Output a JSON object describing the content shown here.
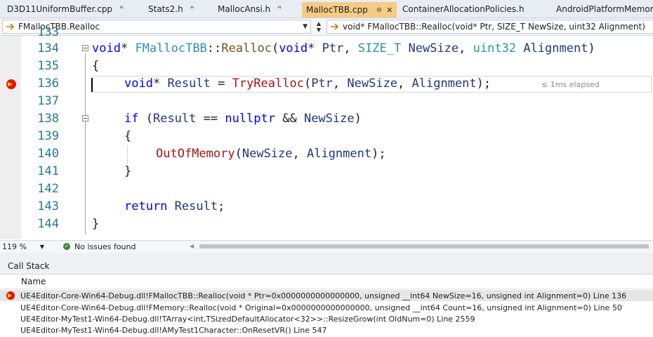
{
  "tabs": [
    {
      "label": "D3D11UniformBuffer.cpp",
      "pin": "ꟸ",
      "active": false
    },
    {
      "label": "Stats2.h",
      "pin": "ꟸ",
      "active": false
    },
    {
      "label": "MallocAnsi.h",
      "pin": "ꟸ",
      "active": false
    },
    {
      "label": "MallocTBB.cpp",
      "pin": "⊕",
      "close": "✕",
      "active": true
    },
    {
      "label": "ContainerAllocationPolicies.h",
      "pin": "",
      "active": false
    },
    {
      "label": "AndroidPlatformMemor",
      "pin": "",
      "active": false
    }
  ],
  "nav": {
    "scope": "FMallocTBB.Realloc",
    "function": "void* FMallocTBB::Realloc(void* Ptr, SIZE_T NewSize, uint32 Alignment)"
  },
  "editor": {
    "lines": [
      {
        "num": "133",
        "text": ""
      },
      {
        "num": "134"
      },
      {
        "num": "135"
      },
      {
        "num": "136"
      },
      {
        "num": "137"
      },
      {
        "num": "138"
      },
      {
        "num": "139"
      },
      {
        "num": "140"
      },
      {
        "num": "141"
      },
      {
        "num": "142"
      },
      {
        "num": "143"
      },
      {
        "num": "144"
      }
    ],
    "code": {
      "l134_void": "void",
      "l134_star": "* ",
      "l134_class": "FMallocTBB",
      "l134_sep": "::",
      "l134_fn": "Realloc",
      "l134_open": "(",
      "l134_void2": "void",
      "l134_p1": "* ",
      "l134_ptr": "Ptr",
      "l134_comma1": ", ",
      "l134_sizet": "SIZE_T",
      "l134_sp": " ",
      "l134_newsize": "NewSize",
      "l134_comma2": ", ",
      "l134_uint32": "uint32",
      "l134_sp2": " ",
      "l134_align": "Alignment",
      "l134_close": ")",
      "l135": "{",
      "l136_void": "void",
      "l136_star": "* ",
      "l136_result": "Result",
      "l136_eq": " = ",
      "l136_fn": "TryRealloc",
      "l136_open": "(",
      "l136_ptr": "Ptr",
      "l136_c1": ", ",
      "l136_newsize": "NewSize",
      "l136_c2": ", ",
      "l136_align": "Alignment",
      "l136_close": ");",
      "l136_elapsed": "≤ 1ms elapsed",
      "l138_if": "if",
      "l138_open": " (",
      "l138_result": "Result",
      "l138_eq": " == ",
      "l138_null": "nullptr",
      "l138_and": " && ",
      "l138_newsize": "NewSize",
      "l138_close": ")",
      "l139": "{",
      "l140_fn": "OutOfMemory",
      "l140_open": "(",
      "l140_newsize": "NewSize",
      "l140_c": ", ",
      "l140_align": "Alignment",
      "l140_close": ");",
      "l141": "}",
      "l143_return": "return",
      "l143_sp": " ",
      "l143_result": "Result",
      "l143_semi": ";",
      "l144": "}"
    }
  },
  "status": {
    "zoom": "119 %",
    "issues": "No issues found"
  },
  "callstack": {
    "title": "Call Stack",
    "column": "Name",
    "rows": [
      "UE4Editor-Core-Win64-Debug.dll!FMallocTBB::Realloc(void * Ptr=0x0000000000000000, unsigned __int64 NewSize=16, unsigned int Alignment=0) Line 136",
      "UE4Editor-Core-Win64-Debug.dll!FMemory::Realloc(void * Original=0x0000000000000000, unsigned __int64 Count=16, unsigned int Alignment=0) Line 50",
      "UE4Editor-MyTest1-Win64-Debug.dll!TArray<int,TSizedDefaultAllocator<32>>::ResizeGrow(int OldNum=0) Line 2559",
      "UE4Editor-MyTest1-Win64-Debug.dll!AMyTest1Character::OnResetVR() Line 547"
    ]
  },
  "colors": {
    "keyword": "#0000ff",
    "type": "#2b91af",
    "function": "#74531f",
    "active_tab": "#f5cc84",
    "breakpoint": "#e51400",
    "line_number": "#237893"
  }
}
